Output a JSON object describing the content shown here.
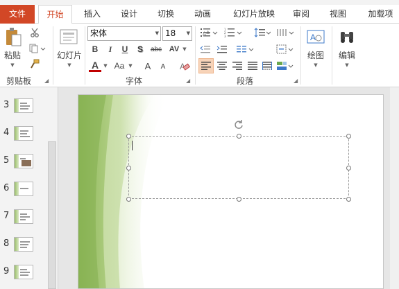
{
  "tabs": [
    "文件",
    "开始",
    "插入",
    "设计",
    "切换",
    "动画",
    "幻灯片放映",
    "审阅",
    "视图",
    "加载项"
  ],
  "ribbon": {
    "clipboard": {
      "label": "剪贴板",
      "paste": "粘贴"
    },
    "slides": {
      "new_slide": "幻灯片"
    },
    "font": {
      "label": "字体",
      "font_name": "宋体",
      "font_size": "18",
      "bold": "B",
      "italic": "I",
      "underline": "U",
      "shadow": "S",
      "strike": "abc",
      "spacing": "AV",
      "font_color": "A",
      "change_case": "Aa",
      "grow": "A",
      "shrink": "A"
    },
    "paragraph": {
      "label": "段落"
    },
    "drawing": {
      "label": "绘图"
    },
    "editing": {
      "label": "编辑"
    }
  },
  "slides_panel": {
    "numbers": [
      "3",
      "4",
      "5",
      "6",
      "7",
      "8",
      "9"
    ]
  },
  "colors": {
    "accent": "#d24726",
    "theme_green": "#9bbf6a"
  }
}
